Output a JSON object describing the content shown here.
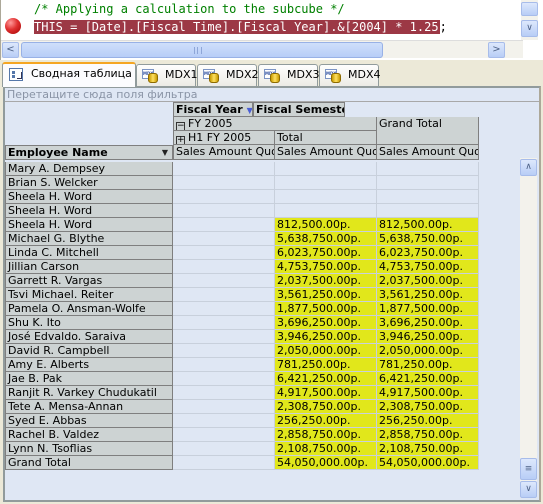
{
  "editor": {
    "comment_line": "/* Applying a calculation to the subcube */",
    "code_line": "THIS = [Date].[Fiscal Time].[Fiscal Year].&[2004] * 1.25",
    "code_terminator": ";",
    "breakpoint_icon": "breakpoint-icon",
    "highlight_color": "#9c3845"
  },
  "tabs": [
    {
      "label": "Сводная таблица",
      "icon": "pivot-table-icon",
      "active": true
    },
    {
      "label": "MDX1",
      "icon": "mdx-query-icon",
      "active": false
    },
    {
      "label": "MDX2",
      "icon": "mdx-query-icon",
      "active": false
    },
    {
      "label": "MDX3",
      "icon": "mdx-query-icon",
      "active": false
    },
    {
      "label": "MDX4",
      "icon": "mdx-query-icon",
      "active": false
    }
  ],
  "pivot": {
    "filter_placeholder": "Перетащите сюда поля фильтра",
    "column_fields": [
      "Fiscal Year",
      "Fiscal Semester"
    ],
    "row_field": "Employee Name",
    "col_headers": {
      "level1": {
        "label": "FY 2005",
        "expander": "−"
      },
      "level1_grand": "Grand Total",
      "level2": [
        {
          "label": "H1 FY 2005",
          "expander": "+"
        },
        {
          "label": "Total"
        }
      ],
      "measure": [
        "Sales Amount Quota",
        "Sales Amount Quota",
        "Sales Amount Quota"
      ]
    },
    "highlight_color": "#e1e71b",
    "rows": [
      {
        "name": "Mary A. Dempsey",
        "h1": "",
        "total": "",
        "grand": ""
      },
      {
        "name": "Brian S. Welcker",
        "h1": "",
        "total": "",
        "grand": ""
      },
      {
        "name": "Sheela H. Word",
        "h1": "",
        "total": "",
        "grand": ""
      },
      {
        "name": "Sheela H. Word",
        "h1": "",
        "total": "",
        "grand": ""
      },
      {
        "name": "Sheela H. Word",
        "h1": "",
        "total": "812,500.00р.",
        "grand": "812,500.00р."
      },
      {
        "name": "Michael G. Blythe",
        "h1": "",
        "total": "5,638,750.00р.",
        "grand": "5,638,750.00р."
      },
      {
        "name": "Linda C. Mitchell",
        "h1": "",
        "total": "6,023,750.00р.",
        "grand": "6,023,750.00р."
      },
      {
        "name": "Jillian Carson",
        "h1": "",
        "total": "4,753,750.00р.",
        "grand": "4,753,750.00р."
      },
      {
        "name": "Garrett R. Vargas",
        "h1": "",
        "total": "2,037,500.00р.",
        "grand": "2,037,500.00р."
      },
      {
        "name": "Tsvi Michael. Reiter",
        "h1": "",
        "total": "3,561,250.00р.",
        "grand": "3,561,250.00р."
      },
      {
        "name": "Pamela O. Ansman-Wolfe",
        "h1": "",
        "total": "1,877,500.00р.",
        "grand": "1,877,500.00р."
      },
      {
        "name": "Shu K. Ito",
        "h1": "",
        "total": "3,696,250.00р.",
        "grand": "3,696,250.00р."
      },
      {
        "name": "José Edvaldo. Saraiva",
        "h1": "",
        "total": "3,946,250.00р.",
        "grand": "3,946,250.00р."
      },
      {
        "name": "David R. Campbell",
        "h1": "",
        "total": "2,050,000.00р.",
        "grand": "2,050,000.00р."
      },
      {
        "name": "Amy E. Alberts",
        "h1": "",
        "total": "781,250.00р.",
        "grand": "781,250.00р."
      },
      {
        "name": "Jae B. Pak",
        "h1": "",
        "total": "6,421,250.00р.",
        "grand": "6,421,250.00р."
      },
      {
        "name": "Ranjit R. Varkey Chudukatil",
        "h1": "",
        "total": "4,917,500.00р.",
        "grand": "4,917,500.00р."
      },
      {
        "name": "Tete A. Mensa-Annan",
        "h1": "",
        "total": "2,308,750.00р.",
        "grand": "2,308,750.00р."
      },
      {
        "name": "Syed E. Abbas",
        "h1": "",
        "total": "256,250.00р.",
        "grand": "256,250.00р."
      },
      {
        "name": "Rachel B. Valdez",
        "h1": "",
        "total": "2,858,750.00р.",
        "grand": "2,858,750.00р."
      },
      {
        "name": "Lynn N. Tsoflias",
        "h1": "",
        "total": "2,108,750.00р.",
        "grand": "2,108,750.00р."
      },
      {
        "name": "Grand Total",
        "h1": "",
        "total": "54,050,000.00р.",
        "grand": "54,050,000.00р."
      }
    ]
  }
}
